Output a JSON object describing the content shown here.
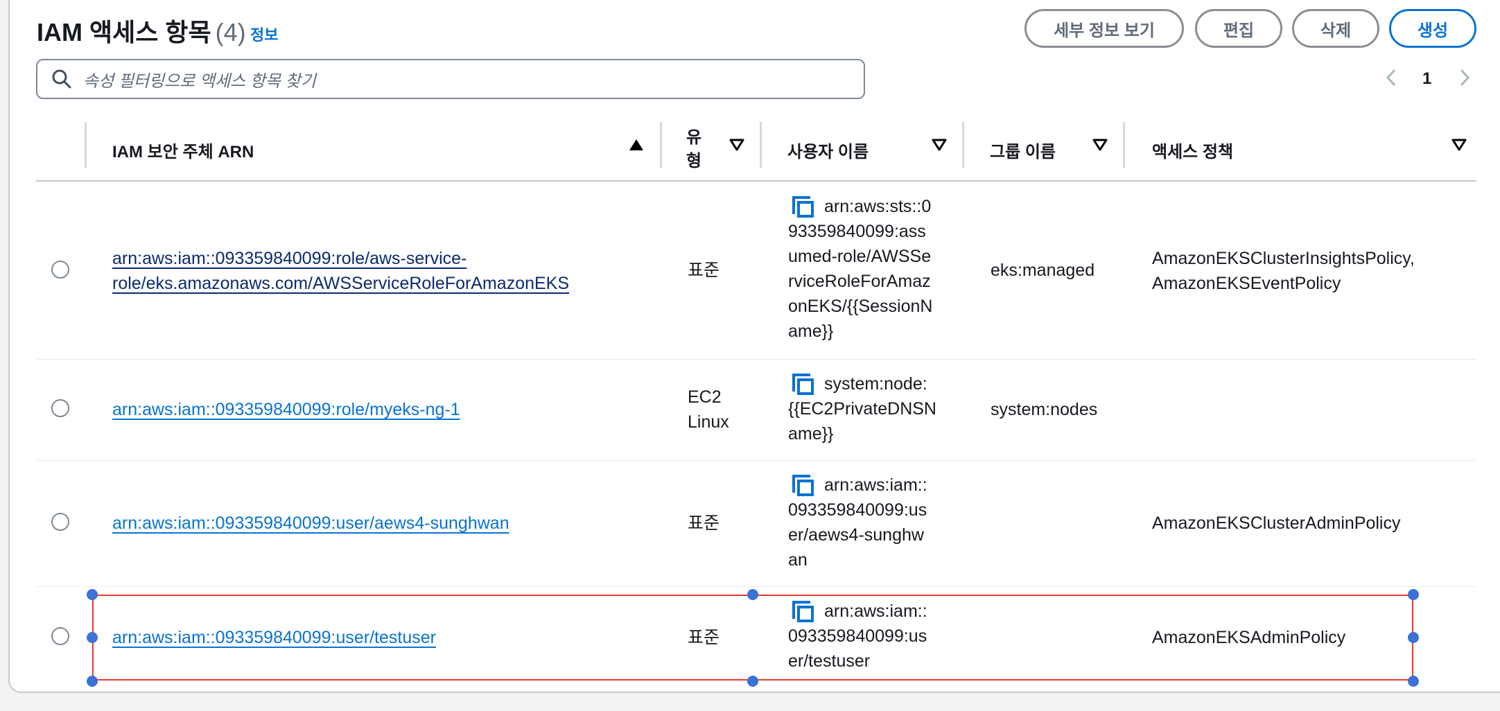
{
  "header": {
    "title": "IAM 액세스 항목",
    "count": "(4)",
    "info": "정보"
  },
  "actions": {
    "view_details": "세부 정보 보기",
    "edit": "편집",
    "delete": "삭제",
    "create": "생성"
  },
  "search": {
    "placeholder": "속성 필터링으로 액세스 항목 찾기"
  },
  "pagination": {
    "current_page": "1"
  },
  "columns": {
    "arn": "IAM 보안 주체 ARN",
    "type_line1": "유",
    "type_line2": "형",
    "username": "사용자 이름",
    "group": "그룹 이름",
    "policy": "액세스 정책"
  },
  "rows": [
    {
      "arn_line1": "arn:aws:iam::093359840099:role/aws-service-",
      "arn_line2": "role/eks.amazonaws.com/AWSServiceRoleForAmazonEKS",
      "type_line1": "표준",
      "type_line2": "",
      "username_lines": [
        "arn:aws:sts::0",
        "93359840099:ass",
        "umed-role/AWSSe",
        "rviceRoleForAmaz",
        "onEKS/{{SessionN",
        "ame}}"
      ],
      "group": "eks:managed",
      "policy_line1": "AmazonEKSClusterInsightsPolicy,",
      "policy_line2": "AmazonEKSEventPolicy"
    },
    {
      "arn_line1": "arn:aws:iam::093359840099:role/myeks-ng-1",
      "arn_line2": "",
      "type_line1": "EC2",
      "type_line2": "Linux",
      "username_lines": [
        "system:node:",
        "{{EC2PrivateDNSN",
        "ame}}"
      ],
      "group": "system:nodes",
      "policy_line1": "",
      "policy_line2": ""
    },
    {
      "arn_line1": "arn:aws:iam::093359840099:user/aews4-sunghwan",
      "arn_line2": "",
      "type_line1": "표준",
      "type_line2": "",
      "username_lines": [
        "arn:aws:iam::",
        "093359840099:us",
        "er/aews4-sunghw",
        "an"
      ],
      "group": "",
      "policy_line1": "AmazonEKSClusterAdminPolicy",
      "policy_line2": ""
    },
    {
      "arn_line1": "arn:aws:iam::093359840099:user/testuser",
      "arn_line2": "",
      "type_line1": "표준",
      "type_line2": "",
      "username_lines": [
        "arn:aws:iam::",
        "093359840099:us",
        "er/testuser"
      ],
      "group": "",
      "policy_line1": "AmazonEKSAdminPolicy",
      "policy_line2": ""
    }
  ],
  "colors": {
    "link": "#0972d3",
    "selection_border": "#e8392f",
    "handle": "#3c72d6"
  }
}
